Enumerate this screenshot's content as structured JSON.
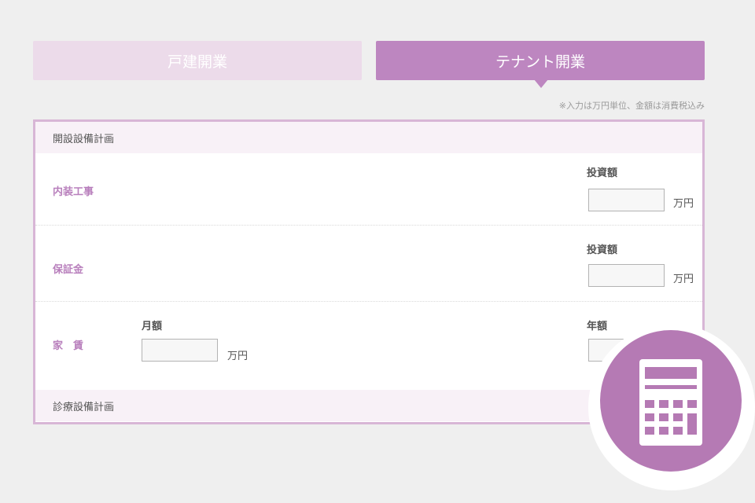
{
  "tabs": [
    {
      "label": "戸建開業",
      "active": false
    },
    {
      "label": "テナント開業",
      "active": true
    }
  ],
  "note": "※入力は万円単位、金額は消費税込み",
  "sections": {
    "facility_plan": {
      "title": "開設設備計画"
    },
    "medical_plan": {
      "title": "診療設備計画"
    }
  },
  "rows": {
    "interior": {
      "label": "内装工事",
      "field_label": "投資額",
      "unit": "万円",
      "value": ""
    },
    "deposit": {
      "label": "保証金",
      "field_label": "投資額",
      "unit": "万円",
      "value": ""
    },
    "rent": {
      "label": "家　賃",
      "monthly_label": "月額",
      "monthly_unit": "万円",
      "monthly_value": "",
      "annual_label": "年額",
      "annual_value": ""
    }
  },
  "icons": {
    "calculator": "calculator-icon"
  },
  "colors": {
    "accent": "#bd86c0",
    "accent_light": "#ecdbea",
    "label_purple": "#b87fbc",
    "panel_border": "#d8b6d6",
    "calc_circle": "#b57ab4",
    "background": "#efefef"
  }
}
